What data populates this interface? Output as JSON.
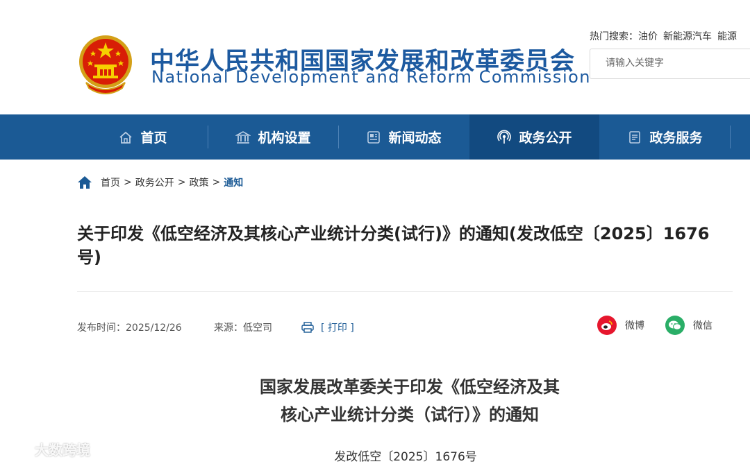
{
  "header": {
    "title_cn": "中华人民共和国国家发展和改革委员会",
    "title_en": "National Development and Reform Commission",
    "hot_search_label": "热门搜索：",
    "hot_search_terms": [
      "油价",
      "新能源汽车",
      "能源"
    ],
    "search_placeholder": "请输入关键字"
  },
  "nav": {
    "items": [
      {
        "label": "首页",
        "icon": "home-icon"
      },
      {
        "label": "机构设置",
        "icon": "building-icon"
      },
      {
        "label": "新闻动态",
        "icon": "news-icon"
      },
      {
        "label": "政务公开",
        "icon": "broadcast-icon"
      },
      {
        "label": "政务服务",
        "icon": "document-icon"
      }
    ],
    "active": "政务公开"
  },
  "breadcrumb": {
    "items": [
      "首页",
      "政务公开",
      "政策",
      "通知"
    ],
    "separator": ">"
  },
  "article": {
    "title": "关于印发《低空经济及其核心产业统计分类(试行)》的通知(发改低空〔2025〕1676号)",
    "publish_label": "发布时间：",
    "publish_date": "2025/12/26",
    "source_label": "来源：",
    "source": "低空司",
    "print_label": "[ 打印 ]",
    "share_weibo": "微博",
    "share_wechat": "微信"
  },
  "body": {
    "doc_title_line1": "国家发展改革委关于印发《低空经济及其",
    "doc_title_line2": "核心产业统计分类（试行）》的通知",
    "doc_number": "发改低空〔2025〕1676号"
  },
  "watermark": {
    "text": "大数跨境"
  },
  "colors": {
    "brand_blue": "#1b5a95",
    "nav_active": "#124a80",
    "title_blue": "#1d5aa0",
    "weibo_red": "#e6162d",
    "wechat_green": "#2aae67"
  }
}
